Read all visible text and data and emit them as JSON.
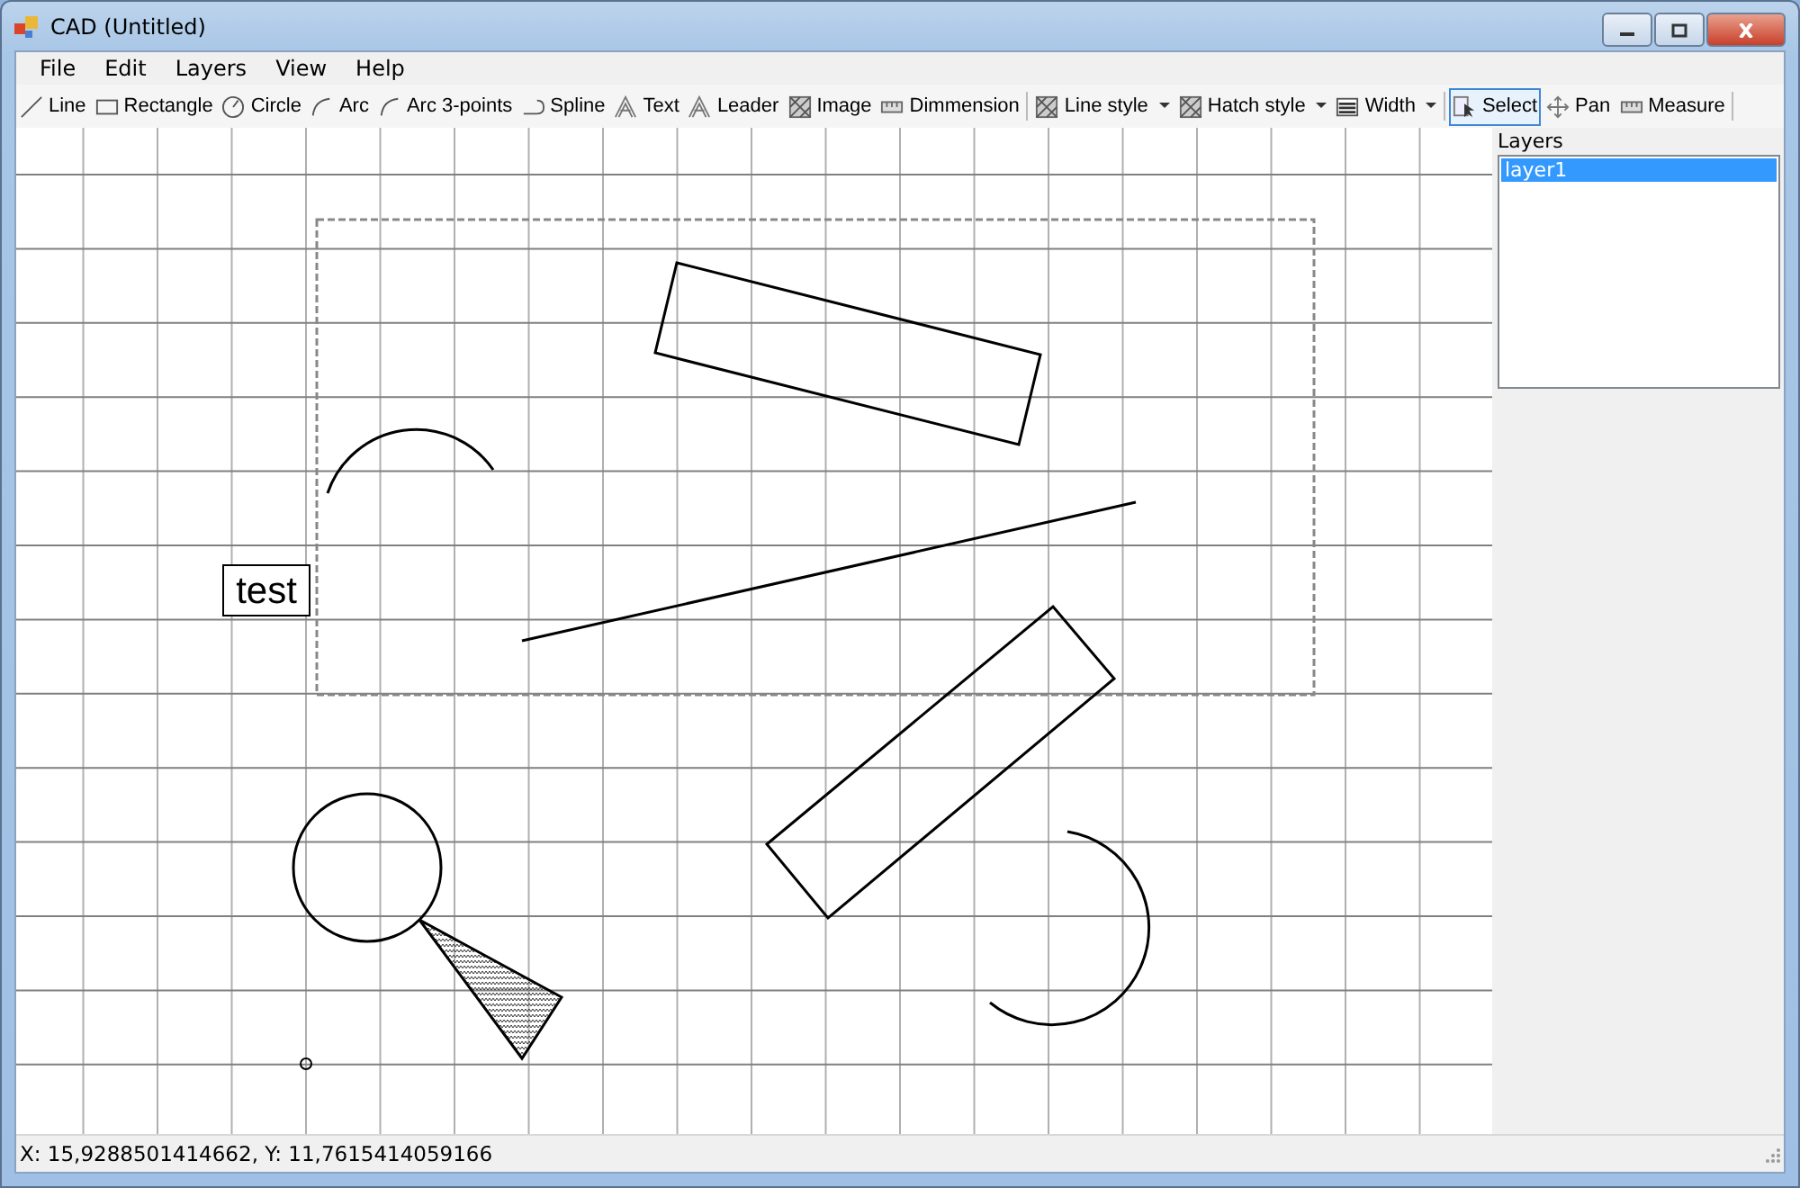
{
  "window": {
    "title": "CAD (Untitled)"
  },
  "menu": [
    "File",
    "Edit",
    "Layers",
    "View",
    "Help"
  ],
  "toolbar": [
    {
      "kind": "tool",
      "label": "Line",
      "selected": false
    },
    {
      "kind": "tool",
      "label": "Rectangle",
      "selected": false
    },
    {
      "kind": "tool",
      "label": "Circle",
      "selected": false
    },
    {
      "kind": "tool",
      "label": "Arc",
      "selected": false
    },
    {
      "kind": "tool",
      "label": "Arc 3-points",
      "selected": false
    },
    {
      "kind": "tool",
      "label": "Spline",
      "selected": false
    },
    {
      "kind": "tool",
      "label": "Text",
      "selected": false
    },
    {
      "kind": "tool",
      "label": "Leader",
      "selected": false
    },
    {
      "kind": "tool",
      "label": "Image",
      "selected": false
    },
    {
      "kind": "tool",
      "label": "Dimmension",
      "selected": false
    },
    {
      "kind": "separator"
    },
    {
      "kind": "dropdown",
      "label": "Line style"
    },
    {
      "kind": "dropdown",
      "label": "Hatch style"
    },
    {
      "kind": "dropdown",
      "label": "Width"
    },
    {
      "kind": "separator"
    },
    {
      "kind": "tool",
      "label": "Select",
      "selected": true
    },
    {
      "kind": "tool",
      "label": "Pan",
      "selected": false
    },
    {
      "kind": "tool",
      "label": "Measure",
      "selected": false
    },
    {
      "kind": "separator"
    }
  ],
  "canvas": {
    "text_labels": [
      "test"
    ]
  },
  "layers": {
    "title": "Layers",
    "items": [
      {
        "label": "layer1",
        "selected": true
      }
    ]
  },
  "status_bar": "X: 15,9288501414662, Y: 11,7615414059166"
}
